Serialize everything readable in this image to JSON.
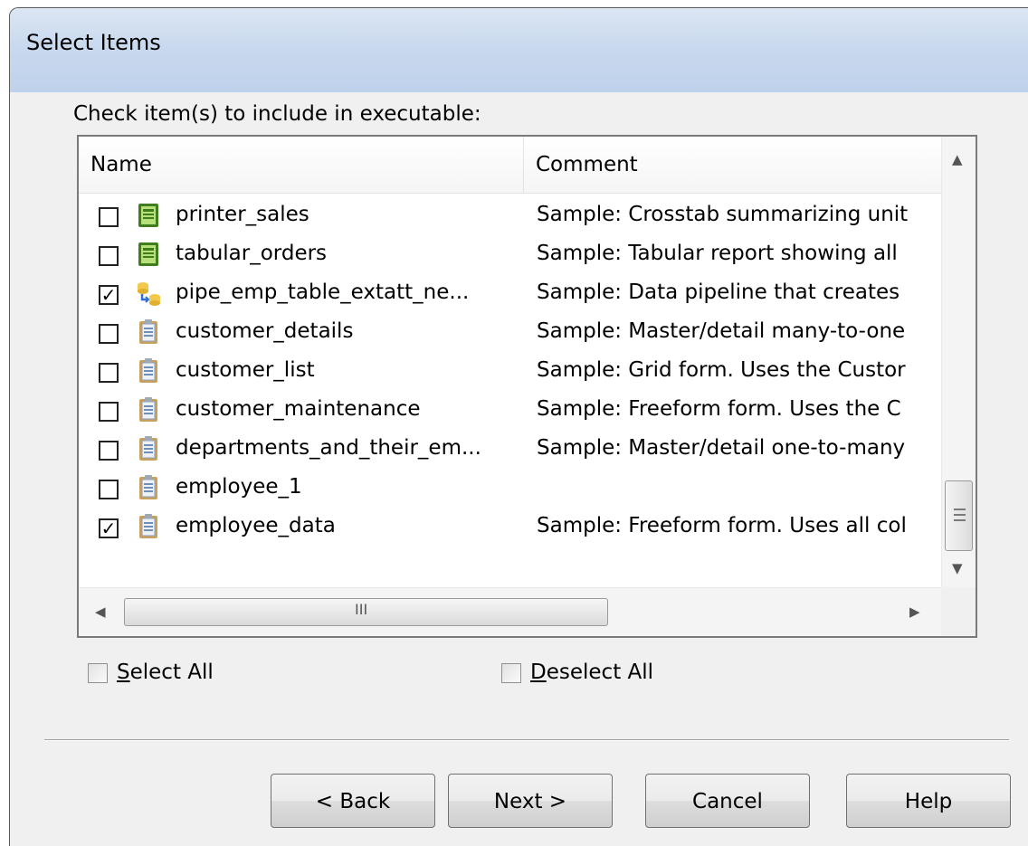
{
  "dialog": {
    "title": "Select Items",
    "prompt": "Check item(s) to include in executable:"
  },
  "list": {
    "columns": {
      "name": "Name",
      "comment": "Comment"
    },
    "rows": [
      {
        "checked": false,
        "icon": "report-icon",
        "name": "printer_sales",
        "comment": "Sample: Crosstab summarizing unit"
      },
      {
        "checked": false,
        "icon": "report-icon",
        "name": "tabular_orders",
        "comment": "Sample: Tabular report showing all"
      },
      {
        "checked": true,
        "icon": "pipeline-icon",
        "name": "pipe_emp_table_extatt_ne...",
        "comment": "Sample: Data pipeline that creates"
      },
      {
        "checked": false,
        "icon": "form-icon",
        "name": "customer_details",
        "comment": "Sample: Master/detail many-to-one"
      },
      {
        "checked": false,
        "icon": "form-icon",
        "name": "customer_list",
        "comment": "Sample: Grid form. Uses the Custor"
      },
      {
        "checked": false,
        "icon": "form-icon",
        "name": "customer_maintenance",
        "comment": "Sample: Freeform form. Uses the C"
      },
      {
        "checked": false,
        "icon": "form-icon",
        "name": "departments_and_their_em...",
        "comment": "Sample: Master/detail one-to-many"
      },
      {
        "checked": false,
        "icon": "form-icon",
        "name": "employee_1",
        "comment": ""
      },
      {
        "checked": true,
        "icon": "form-icon",
        "name": "employee_data",
        "comment": "Sample: Freeform form. Uses all col"
      }
    ]
  },
  "select_all": {
    "prefix": "",
    "accel": "S",
    "rest": "elect All"
  },
  "deselect_all": {
    "prefix": "",
    "accel": "D",
    "rest": "eselect All"
  },
  "buttons": {
    "back": "< Back",
    "next": "Next >",
    "cancel": "Cancel",
    "help": "Help"
  },
  "scrollbar": {
    "grip": "III"
  },
  "colors": {
    "header_gradient_top": "#dce6f3",
    "header_gradient_bottom": "#bfd2eb",
    "dialog_bg": "#f0f0f0"
  }
}
